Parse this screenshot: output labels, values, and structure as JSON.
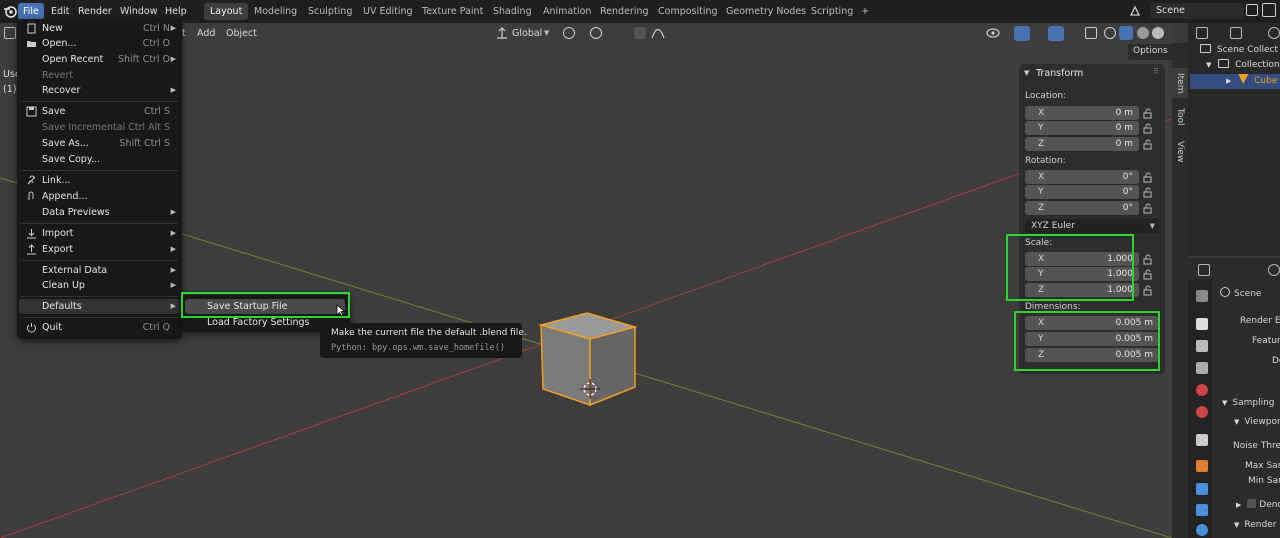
{
  "topbar": {
    "menus": [
      "File",
      "Edit",
      "Render",
      "Window",
      "Help"
    ],
    "tabs": [
      "Layout",
      "Modeling",
      "Sculpting",
      "UV Editing",
      "Texture Paint",
      "Shading",
      "Animation",
      "Rendering",
      "Compositing",
      "Geometry Nodes",
      "Scripting"
    ],
    "add_tab": "+",
    "scene_name": "Scene"
  },
  "viewport_header": {
    "add": "Add",
    "object": "Object",
    "orientation": "Global",
    "options": "Options",
    "overlay_stub": "Use",
    "overlay_stub2": "(1)",
    "hidden_item": "t"
  },
  "file_menu": {
    "items": [
      {
        "label": "New",
        "shortcut": "Ctrl N",
        "arrow": true,
        "icon": "new-file-icon"
      },
      {
        "label": "Open...",
        "shortcut": "Ctrl O",
        "icon": "folder-icon"
      },
      {
        "label": "Open Recent",
        "shortcut": "Shift Ctrl O",
        "arrow": true
      },
      {
        "label": "Revert",
        "disabled": true
      },
      {
        "label": "Recover",
        "arrow": true
      },
      {
        "label": "Save",
        "shortcut": "Ctrl S",
        "icon": "save-icon"
      },
      {
        "label": "Save Incremental",
        "shortcut": "Ctrl Alt S",
        "disabled": true
      },
      {
        "label": "Save As...",
        "shortcut": "Shift Ctrl S"
      },
      {
        "label": "Save Copy..."
      },
      {
        "label": "Link...",
        "icon": "link-icon"
      },
      {
        "label": "Append...",
        "icon": "append-icon"
      },
      {
        "label": "Data Previews",
        "arrow": true
      },
      {
        "label": "Import",
        "arrow": true,
        "icon": "import-icon"
      },
      {
        "label": "Export",
        "arrow": true,
        "icon": "export-icon"
      },
      {
        "label": "External Data",
        "arrow": true
      },
      {
        "label": "Clean Up",
        "arrow": true
      },
      {
        "label": "Defaults",
        "arrow": true
      },
      {
        "label": "Quit",
        "shortcut": "Ctrl Q",
        "icon": "power-icon"
      }
    ]
  },
  "defaults_submenu": {
    "items": [
      "Save Startup File",
      "Load Factory Settings"
    ]
  },
  "tooltip": {
    "title": "Make the current file the default .blend file.",
    "python": "Python: bpy.ops.wm.save_homefile()"
  },
  "transform_panel": {
    "title": "Transform",
    "location_label": "Location:",
    "location": [
      {
        "axis": "X",
        "value": "0 m"
      },
      {
        "axis": "Y",
        "value": "0 m"
      },
      {
        "axis": "Z",
        "value": "0 m"
      }
    ],
    "rotation_label": "Rotation:",
    "rotation": [
      {
        "axis": "X",
        "value": "0°"
      },
      {
        "axis": "Y",
        "value": "0°"
      },
      {
        "axis": "Z",
        "value": "0°"
      }
    ],
    "rotation_mode": "XYZ Euler",
    "scale_label": "Scale:",
    "scale": [
      {
        "axis": "X",
        "value": "1.000"
      },
      {
        "axis": "Y",
        "value": "1.000"
      },
      {
        "axis": "Z",
        "value": "1.000"
      }
    ],
    "dimensions_label": "Dimensions:",
    "dimensions": [
      {
        "axis": "X",
        "value": "0.005 m"
      },
      {
        "axis": "Y",
        "value": "0.005 m"
      },
      {
        "axis": "Z",
        "value": "0.005 m"
      }
    ]
  },
  "side_tabs": [
    "Item",
    "Tool",
    "View"
  ],
  "outliner": {
    "rows": [
      "Scene Collect",
      "Collection",
      "Cube"
    ]
  },
  "properties": {
    "scene": "Scene",
    "rows": [
      "Render En",
      "Featur",
      "De",
      "Sampling",
      "Viewpor",
      "Noise Thres",
      "Max Sam",
      "Min Sam",
      "Deno",
      "Render"
    ]
  },
  "colors": {
    "accent": "#4772b3",
    "highlight_box": "#2ed52e",
    "selection_outline": "#f0a020",
    "x_axis": "#c84848",
    "y_axis": "#7a9a2a"
  }
}
